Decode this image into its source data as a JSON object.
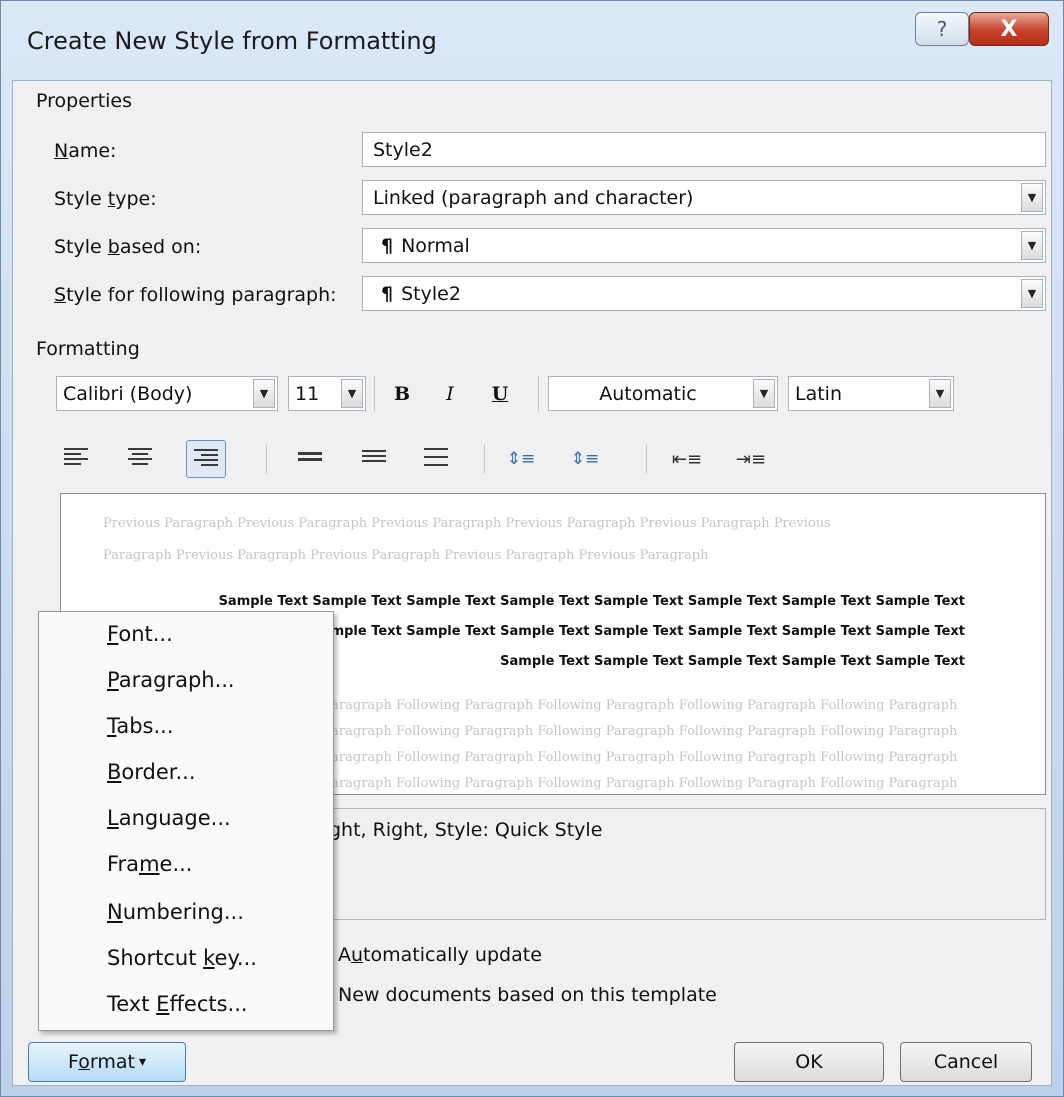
{
  "window": {
    "title": "Create New Style from Formatting",
    "help_glyph": "?",
    "close_glyph": "X"
  },
  "properties": {
    "section_label": "Properties",
    "name_label": "Name:",
    "name_value": "Style2",
    "style_type_label": "Style type:",
    "style_type_value": "Linked (paragraph and character)",
    "based_on_label": "Style based on:",
    "based_on_value": "Normal",
    "following_label": "Style for following paragraph:",
    "following_value": "Style2",
    "pilcrow": "¶"
  },
  "formatting": {
    "section_label": "Formatting",
    "font": "Calibri (Body)",
    "size": "11",
    "bold": "B",
    "italic": "I",
    "underline": "U",
    "color": "Automatic",
    "script": "Latin"
  },
  "preview": {
    "previous_line1": "Previous Paragraph Previous Paragraph Previous Paragraph Previous Paragraph Previous Paragraph Previous",
    "previous_line2": "Paragraph Previous Paragraph Previous Paragraph Previous Paragraph Previous Paragraph",
    "sample_line1": "Sample Text Sample Text Sample Text Sample Text Sample Text Sample Text Sample Text Sample Text",
    "sample_line2": "xt Sample Text Sample Text Sample Text Sample Text Sample Text Sample Text Sample Text",
    "sample_line3": "Sample Text Sample Text Sample Text Sample Text Sample Text",
    "following_line": "Paragraph Following Paragraph Following Paragraph Following Paragraph Following Paragraph"
  },
  "description": "ght, Right, Style: Quick Style",
  "options": {
    "auto_update": "Automatically update",
    "new_docs": "New documents based on this template"
  },
  "buttons": {
    "format": "Format",
    "format_arrow": "▾",
    "ok": "OK",
    "cancel": "Cancel"
  },
  "menu": {
    "items": [
      {
        "pre": "",
        "u": "F",
        "post": "ont..."
      },
      {
        "pre": "",
        "u": "P",
        "post": "aragraph..."
      },
      {
        "pre": "",
        "u": "T",
        "post": "abs..."
      },
      {
        "pre": "",
        "u": "B",
        "post": "order..."
      },
      {
        "pre": "",
        "u": "L",
        "post": "anguage..."
      },
      {
        "pre": "Fra",
        "u": "m",
        "post": "e..."
      },
      {
        "pre": "",
        "u": "N",
        "post": "umbering..."
      },
      {
        "pre": "Shortcut ",
        "u": "k",
        "post": "ey..."
      },
      {
        "pre": "Text ",
        "u": "E",
        "post": "ffects..."
      }
    ]
  },
  "colors": {
    "title_gradient_top": "#dbe8f6",
    "close_red": "#c6402a",
    "format_button": "#b6dbf4"
  }
}
